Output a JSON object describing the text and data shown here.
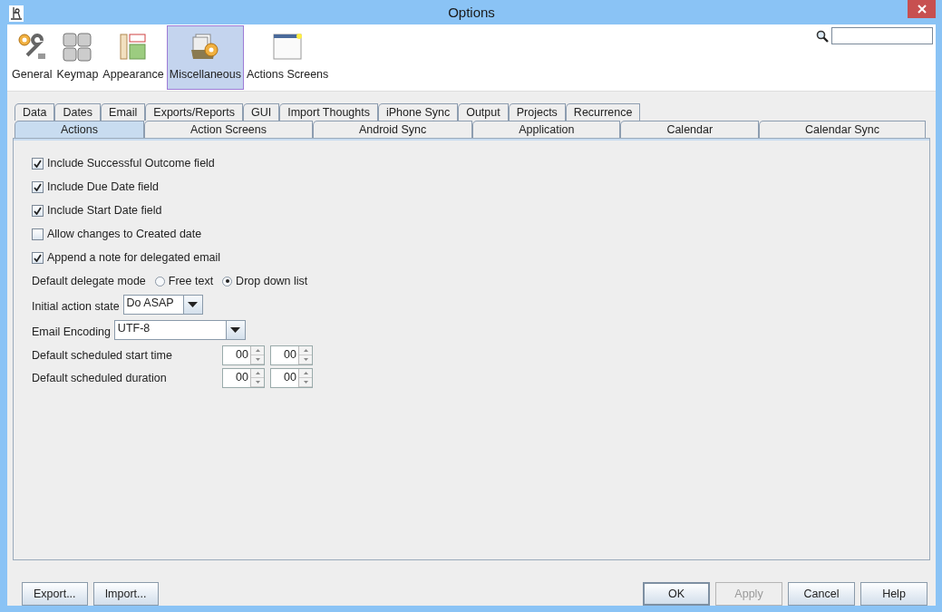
{
  "window": {
    "title": "Options"
  },
  "toolbar": {
    "items": [
      {
        "label": "General",
        "selected": false
      },
      {
        "label": "Keymap",
        "selected": false
      },
      {
        "label": "Appearance",
        "selected": false
      },
      {
        "label": "Miscellaneous",
        "selected": true
      },
      {
        "label": "Actions Screens",
        "selected": false
      }
    ]
  },
  "tab_rows": [
    [
      {
        "label": "Data",
        "selected": false
      },
      {
        "label": "Dates",
        "selected": false
      },
      {
        "label": "Email",
        "selected": false
      },
      {
        "label": "Exports/Reports",
        "selected": false
      },
      {
        "label": "GUI",
        "selected": false
      },
      {
        "label": "Import Thoughts",
        "selected": false
      },
      {
        "label": "iPhone Sync",
        "selected": false
      },
      {
        "label": "Output",
        "selected": false
      },
      {
        "label": "Projects",
        "selected": false
      },
      {
        "label": "Recurrence",
        "selected": false
      }
    ],
    [
      {
        "label": "Actions",
        "selected": true
      },
      {
        "label": "Action Screens",
        "selected": false
      },
      {
        "label": "Android Sync",
        "selected": false
      },
      {
        "label": "Application",
        "selected": false
      },
      {
        "label": "Calendar",
        "selected": false
      },
      {
        "label": "Calendar Sync",
        "selected": false
      }
    ]
  ],
  "settings": [
    {
      "kind": "checkbox",
      "label": "Include Successful Outcome field",
      "checked": true
    },
    {
      "kind": "checkbox",
      "label": "Include Due Date field",
      "checked": true
    },
    {
      "kind": "checkbox",
      "label": "Include Start Date field",
      "checked": true
    },
    {
      "kind": "checkbox",
      "label": "Allow changes to Created date",
      "checked": false
    },
    {
      "kind": "checkbox",
      "label": "Append a note for delegated email",
      "checked": true
    },
    {
      "kind": "radio",
      "label": "Default delegate mode",
      "options": [
        {
          "label": "Free text",
          "selected": false
        },
        {
          "label": "Drop down list",
          "selected": true
        }
      ]
    },
    {
      "kind": "combo",
      "label": "Initial action state",
      "value": "Do ASAP"
    },
    {
      "kind": "combo",
      "label": "Email Encoding",
      "value": "UTF-8"
    },
    {
      "kind": "time",
      "label": "Default scheduled start time",
      "hours": "00",
      "minutes": "00"
    },
    {
      "kind": "time",
      "label": "Default scheduled duration",
      "hours": "00",
      "minutes": "00"
    }
  ],
  "left_buttons": [
    {
      "label": "Export...",
      "disabled": false,
      "default": false
    },
    {
      "label": "Import...",
      "disabled": false,
      "default": false
    }
  ],
  "right_buttons": [
    {
      "label": "OK",
      "disabled": false,
      "default": true
    },
    {
      "label": "Apply",
      "disabled": true,
      "default": false
    },
    {
      "label": "Cancel",
      "disabled": false,
      "default": false
    },
    {
      "label": "Help",
      "disabled": false,
      "default": false
    }
  ]
}
